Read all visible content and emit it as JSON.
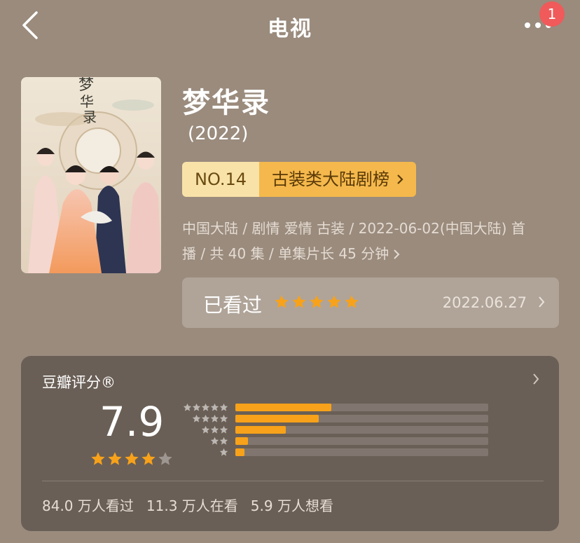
{
  "nav": {
    "title": "电视",
    "badge_count": "1"
  },
  "show": {
    "title": "梦华录",
    "year": "(2022)",
    "rank_no": "NO.14",
    "rank_list": "古装类大陆剧榜",
    "meta_line1": "中国大陆 / 剧情 爱情 古装 / 2022-06-02(中国大陆) 首",
    "meta_line2": "播 / 共 40 集 / 单集片长 45 分钟"
  },
  "watched": {
    "label": "已看过",
    "stars": 5,
    "date": "2022.06.27"
  },
  "rating": {
    "title": "豆瓣评分®",
    "score": "7.9",
    "stars": 4,
    "distribution": [
      {
        "stars": 5,
        "fraction": 0.38
      },
      {
        "stars": 4,
        "fraction": 0.33
      },
      {
        "stars": 3,
        "fraction": 0.2
      },
      {
        "stars": 2,
        "fraction": 0.05
      },
      {
        "stars": 1,
        "fraction": 0.035
      }
    ],
    "stats": [
      "84.0 万人看过",
      "11.3 万人在看",
      "5.9 万人想看"
    ]
  },
  "colors": {
    "background": "#9a8b7d",
    "accent_orange": "#f7a21a",
    "badge_red": "#f05a5a",
    "card": "#6a5f56"
  }
}
